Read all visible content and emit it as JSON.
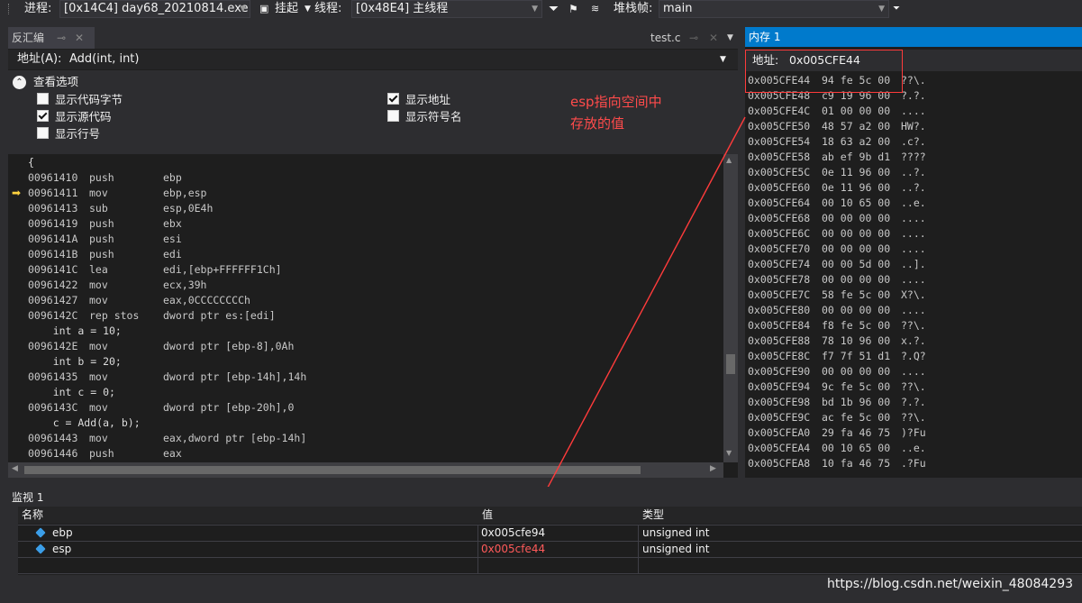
{
  "toolbar": {
    "process_label": "进程:",
    "process_value": "[0x14C4] day68_20210814.exe",
    "suspend_label": "挂起",
    "thread_label": "线程:",
    "thread_value": "[0x48E4] 主线程",
    "stackframe_label": "堆栈帧:",
    "stackframe_value": "main"
  },
  "disasm": {
    "tab_title": "反汇编",
    "source_tab": "test.c",
    "address_label": "地址(A):",
    "address_value": "Add(int, int)",
    "view_options_label": "查看选项",
    "options": {
      "show_code_bytes": "显示代码字节",
      "show_source": "显示源代码",
      "show_line_numbers": "显示行号",
      "show_address": "显示地址",
      "show_symbol_names": "显示符号名"
    },
    "lines": [
      {
        "t": "src",
        "text": "{"
      },
      {
        "t": "asm",
        "addr": "00961410",
        "mn": "push",
        "op": "ebp"
      },
      {
        "t": "asm",
        "addr": "00961411",
        "mn": "mov",
        "op": "ebp,esp"
      },
      {
        "t": "asm",
        "addr": "00961413",
        "mn": "sub",
        "op": "esp,0E4h"
      },
      {
        "t": "asm",
        "addr": "00961419",
        "mn": "push",
        "op": "ebx"
      },
      {
        "t": "asm",
        "addr": "0096141A",
        "mn": "push",
        "op": "esi"
      },
      {
        "t": "asm",
        "addr": "0096141B",
        "mn": "push",
        "op": "edi"
      },
      {
        "t": "asm",
        "addr": "0096141C",
        "mn": "lea",
        "op": "edi,[ebp+FFFFFF1Ch]"
      },
      {
        "t": "asm",
        "addr": "00961422",
        "mn": "mov",
        "op": "ecx,39h"
      },
      {
        "t": "asm",
        "addr": "00961427",
        "mn": "mov",
        "op": "eax,0CCCCCCCCh"
      },
      {
        "t": "asm",
        "addr": "0096142C",
        "mn": "rep stos",
        "op": "dword ptr es:[edi]"
      },
      {
        "t": "src",
        "text": "    int a = 10;"
      },
      {
        "t": "asm",
        "addr": "0096142E",
        "mn": "mov",
        "op": "dword ptr [ebp-8],0Ah"
      },
      {
        "t": "src",
        "text": "    int b = 20;"
      },
      {
        "t": "asm",
        "addr": "00961435",
        "mn": "mov",
        "op": "dword ptr [ebp-14h],14h"
      },
      {
        "t": "src",
        "text": "    int c = 0;"
      },
      {
        "t": "asm",
        "addr": "0096143C",
        "mn": "mov",
        "op": "dword ptr [ebp-20h],0"
      },
      {
        "t": "src",
        "text": "    c = Add(a, b);"
      },
      {
        "t": "asm",
        "addr": "00961443",
        "mn": "mov",
        "op": "eax,dword ptr [ebp-14h]"
      },
      {
        "t": "asm",
        "addr": "00961446",
        "mn": "push",
        "op": "eax"
      }
    ]
  },
  "memory": {
    "tab_title": "内存 1",
    "address_label": "地址:",
    "address_value": "0x005CFE44",
    "rows": [
      {
        "a": "0x005CFE44",
        "b": "94 fe 5c 00",
        "c": "??\\."
      },
      {
        "a": "0x005CFE48",
        "b": "c9 19 96 00",
        "c": "?.?."
      },
      {
        "a": "0x005CFE4C",
        "b": "01 00 00 00",
        "c": "...."
      },
      {
        "a": "0x005CFE50",
        "b": "48 57 a2 00",
        "c": "HW?."
      },
      {
        "a": "0x005CFE54",
        "b": "18 63 a2 00",
        "c": ".c?."
      },
      {
        "a": "0x005CFE58",
        "b": "ab ef 9b d1",
        "c": "????"
      },
      {
        "a": "0x005CFE5C",
        "b": "0e 11 96 00",
        "c": "..?."
      },
      {
        "a": "0x005CFE60",
        "b": "0e 11 96 00",
        "c": "..?."
      },
      {
        "a": "0x005CFE64",
        "b": "00 10 65 00",
        "c": "..e."
      },
      {
        "a": "0x005CFE68",
        "b": "00 00 00 00",
        "c": "...."
      },
      {
        "a": "0x005CFE6C",
        "b": "00 00 00 00",
        "c": "...."
      },
      {
        "a": "0x005CFE70",
        "b": "00 00 00 00",
        "c": "...."
      },
      {
        "a": "0x005CFE74",
        "b": "00 00 5d 00",
        "c": "..]."
      },
      {
        "a": "0x005CFE78",
        "b": "00 00 00 00",
        "c": "...."
      },
      {
        "a": "0x005CFE7C",
        "b": "58 fe 5c 00",
        "c": "X?\\."
      },
      {
        "a": "0x005CFE80",
        "b": "00 00 00 00",
        "c": "...."
      },
      {
        "a": "0x005CFE84",
        "b": "f8 fe 5c 00",
        "c": "??\\."
      },
      {
        "a": "0x005CFE88",
        "b": "78 10 96 00",
        "c": "x.?."
      },
      {
        "a": "0x005CFE8C",
        "b": "f7 7f 51 d1",
        "c": "?.Q?"
      },
      {
        "a": "0x005CFE90",
        "b": "00 00 00 00",
        "c": "...."
      },
      {
        "a": "0x005CFE94",
        "b": "9c fe 5c 00",
        "c": "??\\."
      },
      {
        "a": "0x005CFE98",
        "b": "bd 1b 96 00",
        "c": "?.?."
      },
      {
        "a": "0x005CFE9C",
        "b": "ac fe 5c 00",
        "c": "??\\."
      },
      {
        "a": "0x005CFEA0",
        "b": "29 fa 46 75",
        "c": ")?Fu"
      },
      {
        "a": "0x005CFEA4",
        "b": "00 10 65 00",
        "c": "..e."
      },
      {
        "a": "0x005CFEA8",
        "b": "10 fa 46 75",
        "c": ".?Fu"
      }
    ]
  },
  "watch": {
    "title": "监视 1",
    "col_name": "名称",
    "col_value": "值",
    "col_type": "类型",
    "rows": [
      {
        "name": "ebp",
        "value": "0x005cfe94",
        "type": "unsigned int",
        "changed": false
      },
      {
        "name": "esp",
        "value": "0x005cfe44",
        "type": "unsigned int",
        "changed": true
      }
    ]
  },
  "annotation": {
    "line1": "esp指向空间中",
    "line2": "存放的值",
    "color": "#ff4b4b"
  },
  "watermark": "https://blog.csdn.net/weixin_48084293",
  "colors": {
    "accent": "#007acc",
    "changed_value": "#ff5a5a",
    "annotation": "#ff4b4b"
  }
}
